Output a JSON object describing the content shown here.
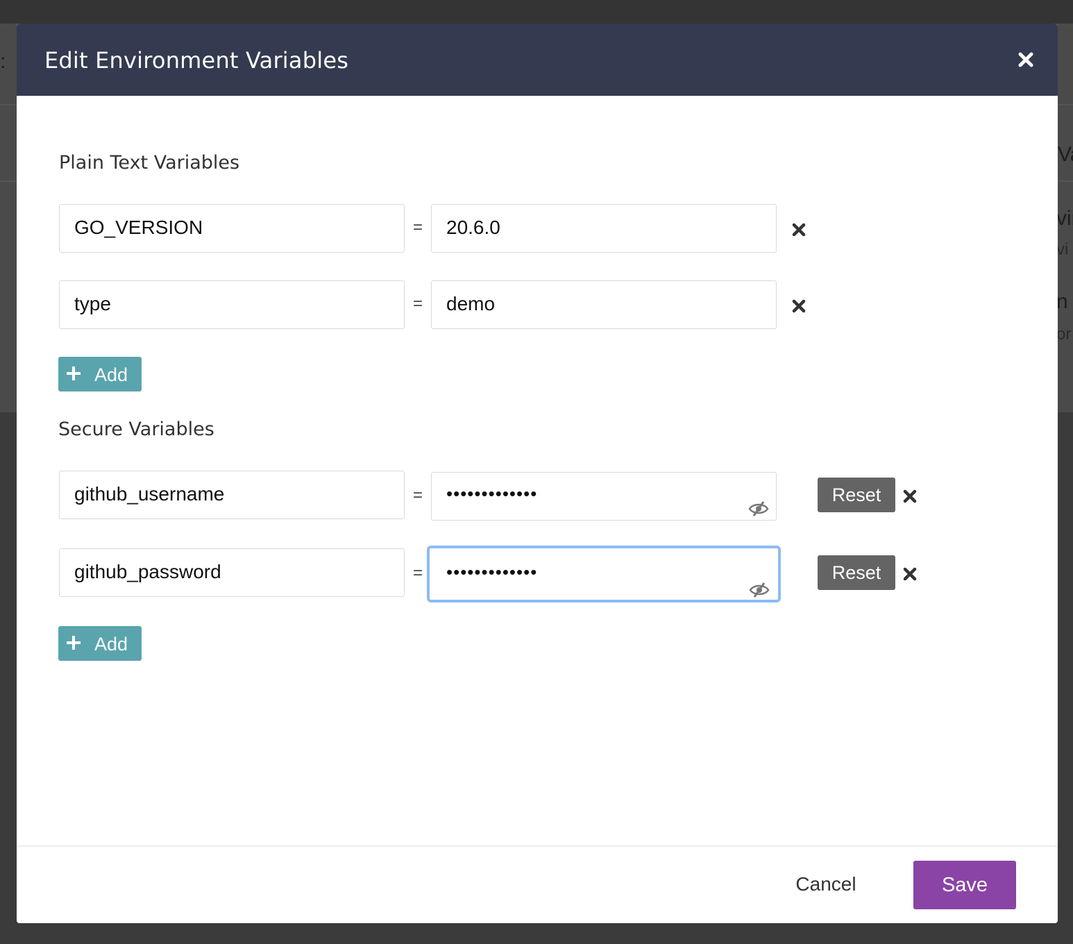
{
  "background": {
    "fragments": [
      ":",
      "Va",
      "vir",
      "vi",
      "n",
      "or"
    ]
  },
  "modal": {
    "title": "Edit Environment Variables",
    "close_icon": "close-icon"
  },
  "plain_section": {
    "title": "Plain Text Variables",
    "rows": [
      {
        "name": "GO_VERSION",
        "value": "20.6.0"
      },
      {
        "name": "type",
        "value": "demo"
      }
    ],
    "add_label": "Add"
  },
  "secure_section": {
    "title": "Secure Variables",
    "rows": [
      {
        "name": "github_username",
        "masked": "•••••••••••••",
        "reset_label": "Reset",
        "focused": false
      },
      {
        "name": "github_password",
        "masked": "•••••••••••••",
        "reset_label": "Reset",
        "focused": true
      }
    ],
    "add_label": "Add"
  },
  "separator": "=",
  "footer": {
    "cancel_label": "Cancel",
    "save_label": "Save"
  },
  "colors": {
    "header_bg": "#343a4f",
    "add_button": "#5aa4ad",
    "reset_button": "#646464",
    "save_button": "#8a44a5",
    "focus_ring": "#8cbbf6"
  }
}
